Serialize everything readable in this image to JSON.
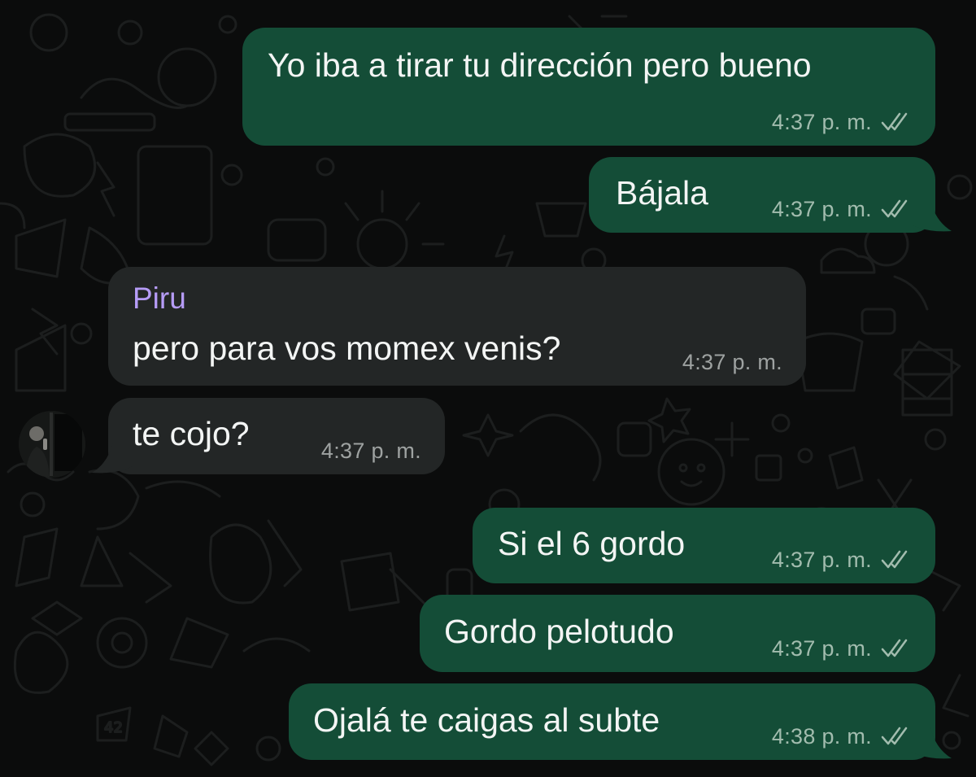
{
  "chat": {
    "messages": [
      {
        "direction": "outgoing",
        "text": "Yo iba a tirar tu dirección pero bueno",
        "time": "4:37 p. m.",
        "status_icon": "double-check-read-icon"
      },
      {
        "direction": "outgoing",
        "text": "Bájala",
        "time": "4:37 p. m.",
        "status_icon": "double-check-read-icon"
      },
      {
        "direction": "incoming",
        "sender": "Piru",
        "text": "pero para vos momex venis?",
        "time": "4:37 p. m."
      },
      {
        "direction": "incoming",
        "text": "te cojo?",
        "time": "4:37 p. m.",
        "avatar": "contact-avatar"
      },
      {
        "direction": "outgoing",
        "text": "Si el 6 gordo",
        "time": "4:37 p. m.",
        "status_icon": "double-check-read-icon"
      },
      {
        "direction": "outgoing",
        "text": "Gordo pelotudo",
        "time": "4:37 p. m.",
        "status_icon": "double-check-read-icon"
      },
      {
        "direction": "outgoing",
        "text": "Ojalá te caigas al subte",
        "time": "4:38 p. m.",
        "status_icon": "double-check-read-icon"
      }
    ]
  },
  "colors": {
    "background": "#0b0c0c",
    "outgoing_bubble": "#144d37",
    "incoming_bubble": "#232626",
    "sender_name": "#b69cf7",
    "message_text": "#f3f5f4"
  }
}
